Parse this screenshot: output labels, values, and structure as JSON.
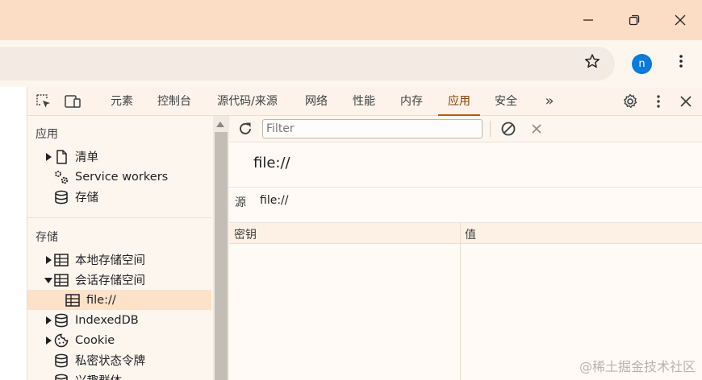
{
  "window": {
    "controls": [
      "minimize-icon",
      "restore-icon",
      "close-icon"
    ]
  },
  "browser": {
    "profile_initial": "n"
  },
  "devtools": {
    "tabs": [
      {
        "label": "元素"
      },
      {
        "label": "控制台"
      },
      {
        "label": "源代码/来源"
      },
      {
        "label": "网络"
      },
      {
        "label": "性能"
      },
      {
        "label": "内存"
      },
      {
        "label": "应用"
      },
      {
        "label": "安全"
      }
    ],
    "more_tabs": "»",
    "active_tab": "应用"
  },
  "sidebar": {
    "app_section": "应用",
    "app_items": [
      {
        "label": "清单",
        "icon": "file-icon"
      },
      {
        "label": "Service workers",
        "icon": "gears-icon"
      },
      {
        "label": "存储",
        "icon": "database-icon"
      }
    ],
    "storage_section": "存储",
    "storage_items": [
      {
        "label": "本地存储空间",
        "icon": "table-icon"
      },
      {
        "label": "会话存储空间",
        "icon": "table-icon"
      },
      {
        "label": "file://",
        "icon": "table-icon"
      },
      {
        "label": "IndexedDB",
        "icon": "database-icon"
      },
      {
        "label": "Cookie",
        "icon": "cookie-icon"
      },
      {
        "label": "私密状态令牌",
        "icon": "database-icon"
      },
      {
        "label": "兴趣群体",
        "icon": "database-icon"
      }
    ]
  },
  "main": {
    "filter_placeholder": "Filter",
    "origin_title": "file://",
    "origin_label": "源",
    "origin_value": "file://",
    "columns": [
      "密钥",
      "值"
    ]
  },
  "watermark": "@稀土掘金技术社区"
}
